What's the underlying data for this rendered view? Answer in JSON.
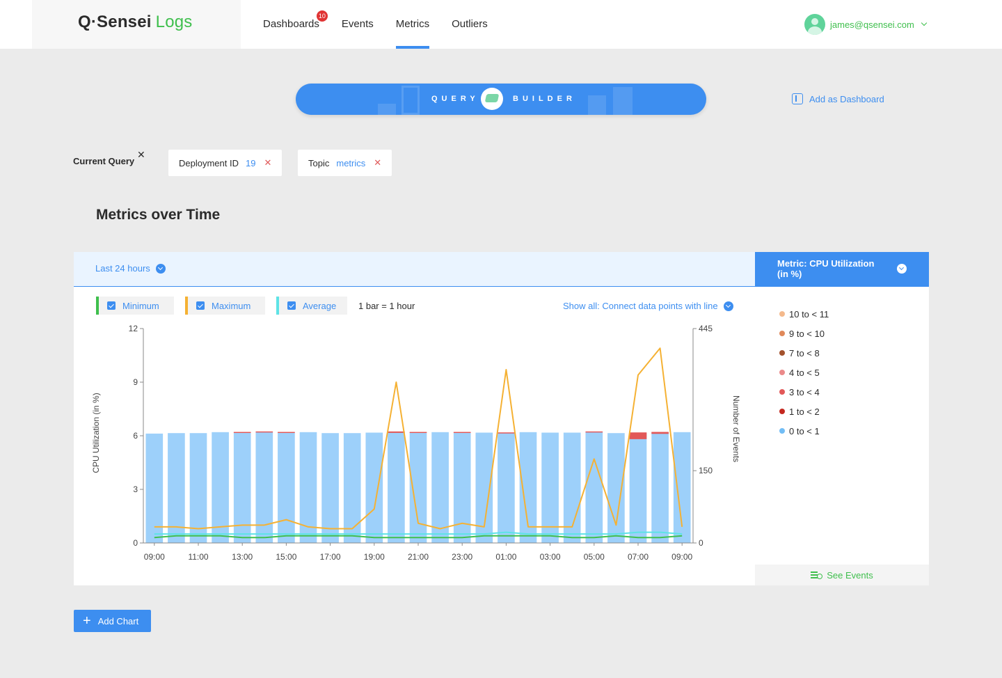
{
  "header": {
    "logo_brand": "Q·Sensei",
    "logo_product": "Logs",
    "nav": [
      {
        "label": "Dashboards",
        "badge": "10"
      },
      {
        "label": "Events"
      },
      {
        "label": "Metrics",
        "active": true
      },
      {
        "label": "Outliers"
      }
    ],
    "user_email": "james@qsensei.com"
  },
  "query_builder": {
    "left": "QUERY",
    "right": "BUILDER",
    "add_dashboard": "Add as Dashboard"
  },
  "current_query": {
    "label": "Current Query",
    "chips": [
      {
        "key": "Deployment ID",
        "value": "19"
      },
      {
        "key": "Topic",
        "value": "metrics"
      }
    ]
  },
  "section_title": "Metrics over Time",
  "panel": {
    "time_range": "Last 24 hours",
    "series_toggles": [
      {
        "label": "Minimum",
        "color": "#3fbf4d"
      },
      {
        "label": "Maximum",
        "color": "#f5b133"
      },
      {
        "label": "Average",
        "color": "#5ee3e6"
      }
    ],
    "bar_note": "1 bar = 1 hour",
    "show_all": "Show all: Connect data points with line"
  },
  "metric_panel": {
    "title": "Metric: CPU Utilization (in %)",
    "buckets": [
      {
        "label": "10 to < 11",
        "color": "#f4b98c"
      },
      {
        "label": "9 to < 10",
        "color": "#e0895a"
      },
      {
        "label": "7 to < 8",
        "color": "#a3522d"
      },
      {
        "label": "4 to < 5",
        "color": "#eb8a8a"
      },
      {
        "label": "3 to < 4",
        "color": "#e25858"
      },
      {
        "label": "1 to < 2",
        "color": "#c4281f"
      },
      {
        "label": "0 to < 1",
        "color": "#72bdf5"
      }
    ],
    "see_events": "See Events"
  },
  "add_chart": "Add Chart",
  "chart_data": {
    "type": "bar",
    "ylabel": "CPU Utilization (in %)",
    "y2label": "Number of Events",
    "ylim": [
      0,
      12
    ],
    "y_ticks": [
      0,
      3,
      6,
      9,
      12
    ],
    "y2lim": [
      0,
      445
    ],
    "y2_ticks": [
      0,
      150,
      445
    ],
    "x_tick_labels": [
      "09:00",
      "11:00",
      "13:00",
      "15:00",
      "17:00",
      "19:00",
      "21:00",
      "23:00",
      "01:00",
      "03:00",
      "05:00",
      "07:00",
      "09:00"
    ],
    "events_per_hour": [
      227,
      228,
      228,
      230,
      229,
      230,
      229,
      230,
      228,
      228,
      229,
      230,
      229,
      230,
      229,
      229,
      228,
      230,
      229,
      229,
      230,
      228,
      228,
      229,
      230
    ],
    "events_high_bucket": [
      0,
      0,
      0,
      0,
      2,
      2,
      2,
      0,
      0,
      0,
      0,
      3,
      2,
      0,
      2,
      0,
      2,
      0,
      0,
      0,
      2,
      0,
      14,
      4,
      0
    ],
    "series": [
      {
        "name": "Maximum",
        "color": "#f5b133",
        "values": [
          0.9,
          0.9,
          0.8,
          0.9,
          1.0,
          1.0,
          1.3,
          0.9,
          0.8,
          0.8,
          1.9,
          9.0,
          1.1,
          0.8,
          1.1,
          0.9,
          9.7,
          0.9,
          0.9,
          0.9,
          4.7,
          1.0,
          9.4,
          10.9,
          0.9
        ]
      },
      {
        "name": "Average",
        "color": "#5ee3e6",
        "values": [
          0.5,
          0.5,
          0.5,
          0.5,
          0.5,
          0.5,
          0.5,
          0.5,
          0.5,
          0.5,
          0.5,
          0.5,
          0.5,
          0.5,
          0.5,
          0.5,
          0.6,
          0.5,
          0.5,
          0.5,
          0.5,
          0.5,
          0.6,
          0.6,
          0.5
        ]
      },
      {
        "name": "Minimum",
        "color": "#3fbf4d",
        "values": [
          0.3,
          0.4,
          0.4,
          0.4,
          0.3,
          0.3,
          0.4,
          0.4,
          0.4,
          0.4,
          0.3,
          0.3,
          0.3,
          0.3,
          0.3,
          0.4,
          0.4,
          0.4,
          0.4,
          0.3,
          0.3,
          0.4,
          0.3,
          0.3,
          0.4
        ]
      }
    ]
  }
}
